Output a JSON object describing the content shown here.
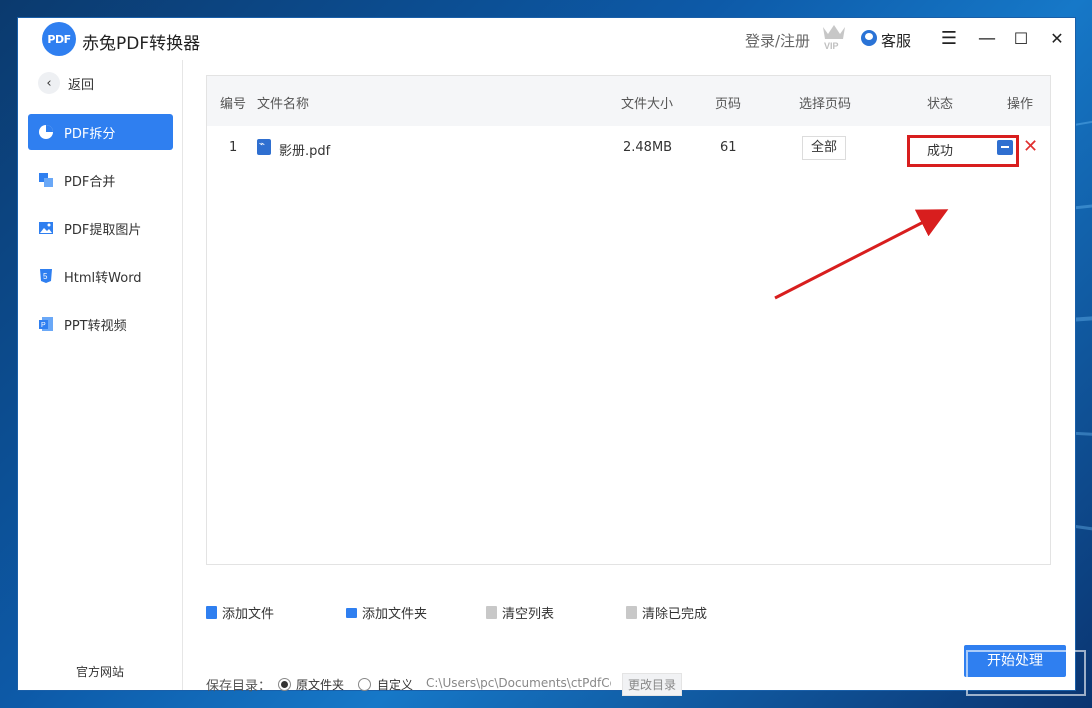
{
  "app": {
    "title": "赤兔PDF转换器",
    "logo_text": "PDF",
    "login_label": "登录/注册",
    "vip_label": "VIP",
    "service_label": "客服"
  },
  "window_controls": {
    "menu": "☰",
    "minimize": "—",
    "maximize": "☐",
    "close": "✕"
  },
  "sidebar": {
    "back_label": "返回",
    "items": [
      {
        "label": "PDF拆分",
        "icon": "pie-chart-icon",
        "active": true
      },
      {
        "label": "PDF合并",
        "icon": "merge-icon",
        "active": false
      },
      {
        "label": "PDF提取图片",
        "icon": "image-icon",
        "active": false
      },
      {
        "label": "Html转Word",
        "icon": "html5-icon",
        "active": false
      },
      {
        "label": "PPT转视频",
        "icon": "ppt-icon",
        "active": false
      }
    ],
    "footer_link": "官方网站"
  },
  "table": {
    "headers": {
      "index": "编号",
      "name": "文件名称",
      "size": "文件大小",
      "pages": "页码",
      "select_pages": "选择页码",
      "status": "状态",
      "ops": "操作"
    },
    "rows": [
      {
        "index": "1",
        "name": "影册.pdf",
        "size": "2.48MB",
        "pages": "61",
        "select_pages": "全部",
        "status": "成功"
      }
    ]
  },
  "actions": {
    "add_file": "添加文件",
    "add_folder": "添加文件夹",
    "clear_list": "清空列表",
    "clear_done": "清除已完成"
  },
  "save": {
    "label": "保存目录：",
    "option_original": "原文件夹",
    "option_custom": "自定义",
    "path": "C:\\Users\\pc\\Documents\\ctPdfCo",
    "change_label": "更改目录"
  },
  "start_label": "开始处理",
  "colors": {
    "accent": "#2f7ff0",
    "highlight": "#d81e1e",
    "delete": "#e03030"
  }
}
